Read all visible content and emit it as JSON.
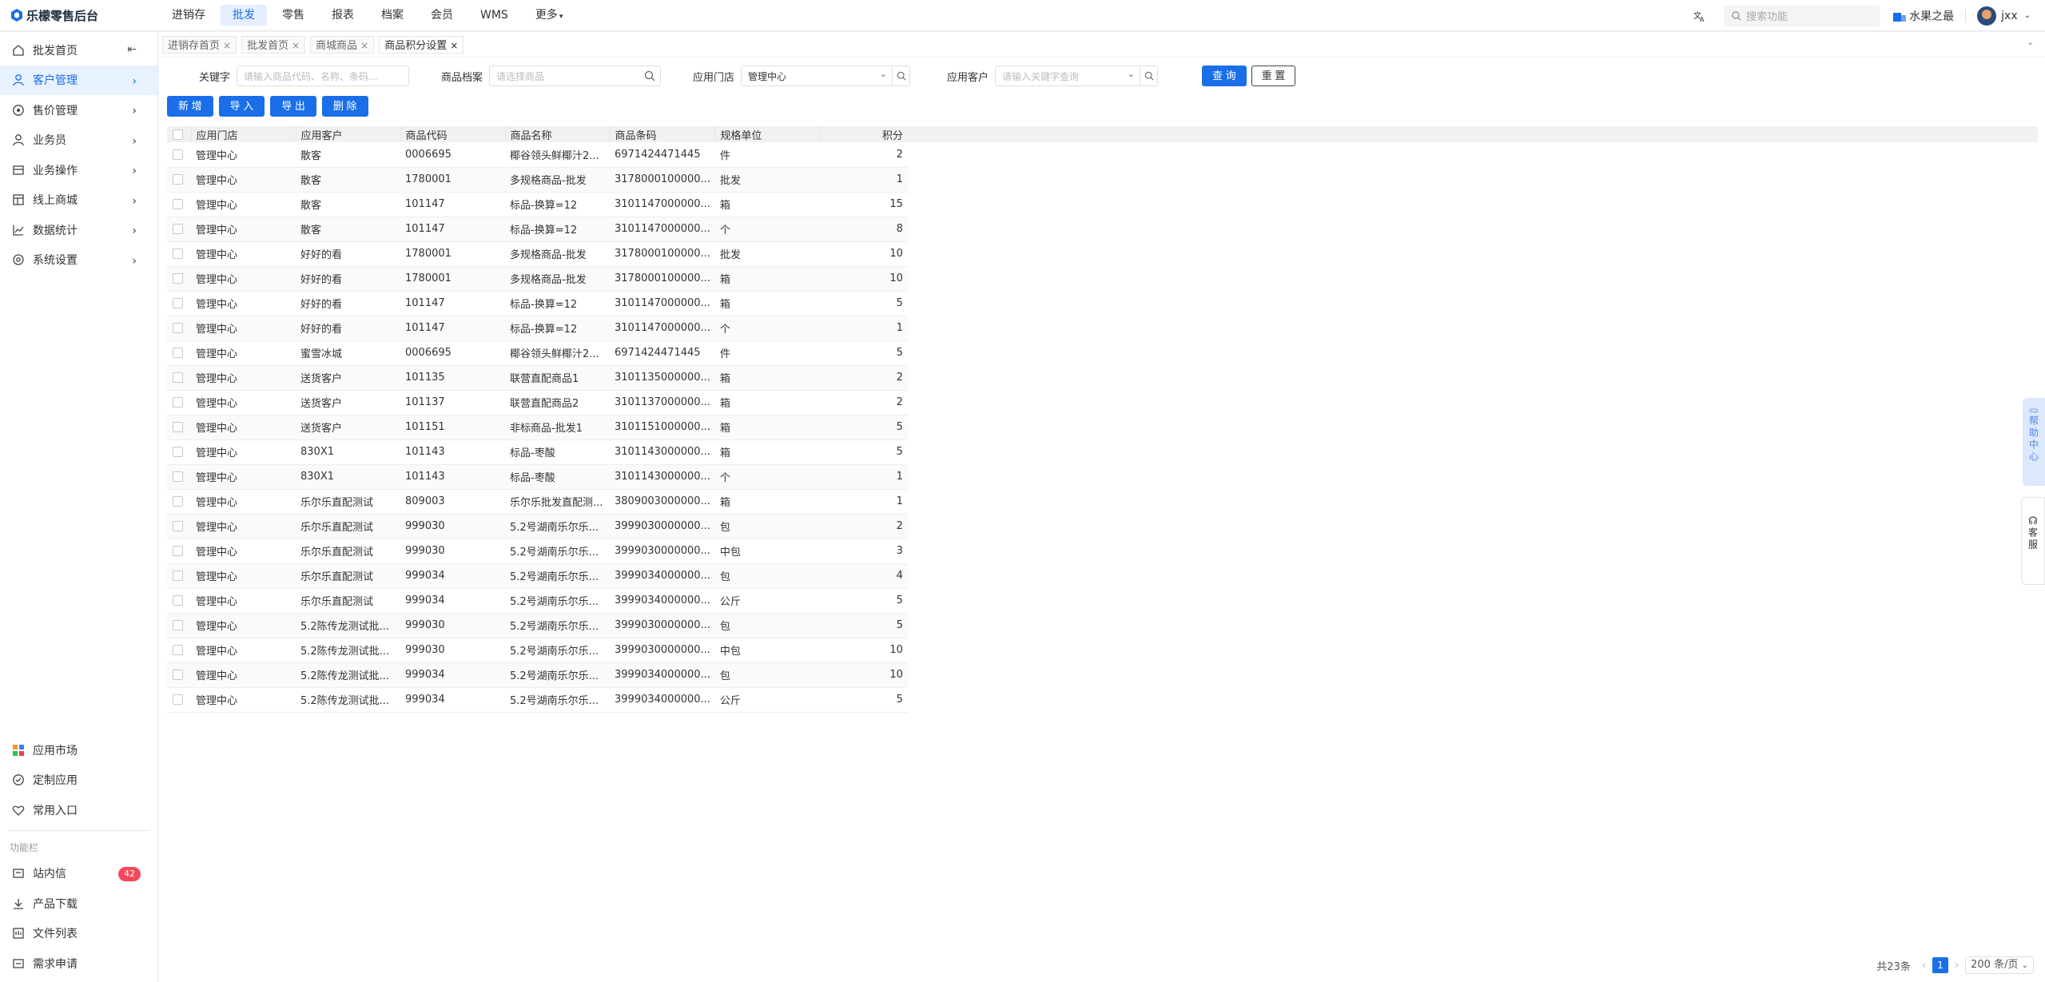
{
  "app": {
    "title": "乐檬零售后台"
  },
  "topnav": [
    "进销存",
    "批发",
    "零售",
    "报表",
    "档案",
    "会员",
    "WMS",
    "更多"
  ],
  "topright": {
    "search_placeholder": "搜索功能",
    "shop": "水果之最",
    "user": "jxx"
  },
  "sidebar": {
    "items": [
      {
        "label": "批发首页",
        "icon": "home-icon"
      },
      {
        "label": "客户管理",
        "icon": "user-icon"
      },
      {
        "label": "售价管理",
        "icon": "price-icon"
      },
      {
        "label": "业务员",
        "icon": "person-icon"
      },
      {
        "label": "业务操作",
        "icon": "ops-icon"
      },
      {
        "label": "线上商城",
        "icon": "shop-icon"
      },
      {
        "label": "数据统计",
        "icon": "chart-icon"
      },
      {
        "label": "系统设置",
        "icon": "settings-icon"
      }
    ],
    "bottom": [
      {
        "label": "应用市场"
      },
      {
        "label": "定制应用"
      },
      {
        "label": "常用入口"
      }
    ],
    "section_label": "功能栏",
    "func": [
      {
        "label": "站内信",
        "badge": "42"
      },
      {
        "label": "产品下载"
      },
      {
        "label": "文件列表"
      },
      {
        "label": "需求申请"
      }
    ]
  },
  "tabs": [
    {
      "label": "进销存首页"
    },
    {
      "label": "批发首页"
    },
    {
      "label": "商城商品"
    },
    {
      "label": "商品积分设置"
    }
  ],
  "filters": {
    "keyword_label": "关键字",
    "keyword_placeholder": "请输入商品代码、名称、条码...",
    "product_label": "商品档案",
    "product_placeholder": "请选择商品",
    "store_label": "应用门店",
    "store_value": "管理中心",
    "customer_label": "应用客户",
    "customer_placeholder": "请输入关键字查询",
    "query": "查 询",
    "reset": "重 置"
  },
  "actions": {
    "add": "新 增",
    "import": "导 入",
    "export": "导 出",
    "delete": "删 除"
  },
  "table": {
    "headers": [
      "应用门店",
      "应用客户",
      "商品代码",
      "商品名称",
      "商品条码",
      "规格单位",
      "积分"
    ],
    "rows": [
      [
        "管理中心",
        "散客",
        "0006695",
        "椰谷领头鲜椰汁2...",
        "6971424471445",
        "件",
        "2"
      ],
      [
        "管理中心",
        "散客",
        "1780001",
        "多规格商品-批发",
        "3178000100000...",
        "批发",
        "1"
      ],
      [
        "管理中心",
        "散客",
        "101147",
        "标品-换算=12",
        "3101147000000...",
        "箱",
        "15"
      ],
      [
        "管理中心",
        "散客",
        "101147",
        "标品-换算=12",
        "3101147000000...",
        "个",
        "8"
      ],
      [
        "管理中心",
        "好好的看",
        "1780001",
        "多规格商品-批发",
        "3178000100000...",
        "批发",
        "10"
      ],
      [
        "管理中心",
        "好好的看",
        "1780001",
        "多规格商品-批发",
        "3178000100000...",
        "箱",
        "10"
      ],
      [
        "管理中心",
        "好好的看",
        "101147",
        "标品-换算=12",
        "3101147000000...",
        "箱",
        "5"
      ],
      [
        "管理中心",
        "好好的看",
        "101147",
        "标品-换算=12",
        "3101147000000...",
        "个",
        "1"
      ],
      [
        "管理中心",
        "蜜雪冰城",
        "0006695",
        "椰谷领头鲜椰汁2...",
        "6971424471445",
        "件",
        "5"
      ],
      [
        "管理中心",
        "送货客户",
        "101135",
        "联营直配商品1",
        "3101135000000...",
        "箱",
        "2"
      ],
      [
        "管理中心",
        "送货客户",
        "101137",
        "联营直配商品2",
        "3101137000000...",
        "箱",
        "2"
      ],
      [
        "管理中心",
        "送货客户",
        "101151",
        "非标商品-批发1",
        "3101151000000...",
        "箱",
        "5"
      ],
      [
        "管理中心",
        "830X1",
        "101143",
        "标品-枣酸",
        "3101143000000...",
        "箱",
        "5"
      ],
      [
        "管理中心",
        "830X1",
        "101143",
        "标品-枣酸",
        "3101143000000...",
        "个",
        "1"
      ],
      [
        "管理中心",
        "乐尔乐直配测试",
        "809003",
        "乐尔乐批发直配测...",
        "3809003000000...",
        "箱",
        "1"
      ],
      [
        "管理中心",
        "乐尔乐直配测试",
        "999030",
        "5.2号湖南乐尔乐...",
        "3999030000000...",
        "包",
        "2"
      ],
      [
        "管理中心",
        "乐尔乐直配测试",
        "999030",
        "5.2号湖南乐尔乐...",
        "3999030000000...",
        "中包",
        "3"
      ],
      [
        "管理中心",
        "乐尔乐直配测试",
        "999034",
        "5.2号湖南乐尔乐...",
        "3999034000000...",
        "包",
        "4"
      ],
      [
        "管理中心",
        "乐尔乐直配测试",
        "999034",
        "5.2号湖南乐尔乐...",
        "3999034000000...",
        "公斤",
        "5"
      ],
      [
        "管理中心",
        "5.2陈传龙测试批...",
        "999030",
        "5.2号湖南乐尔乐...",
        "3999030000000...",
        "包",
        "5"
      ],
      [
        "管理中心",
        "5.2陈传龙测试批...",
        "999030",
        "5.2号湖南乐尔乐...",
        "3999030000000...",
        "中包",
        "10"
      ],
      [
        "管理中心",
        "5.2陈传龙测试批...",
        "999034",
        "5.2号湖南乐尔乐...",
        "3999034000000...",
        "包",
        "10"
      ],
      [
        "管理中心",
        "5.2陈传龙测试批...",
        "999034",
        "5.2号湖南乐尔乐...",
        "3999034000000...",
        "公斤",
        "5"
      ]
    ]
  },
  "pager": {
    "total": "共23条",
    "current": "1",
    "page_size": "200 条/页"
  },
  "float": {
    "help": "帮助中心",
    "service": "客服"
  },
  "colors": {
    "primary": "#1a6fe8",
    "badge": "#f5475b"
  }
}
